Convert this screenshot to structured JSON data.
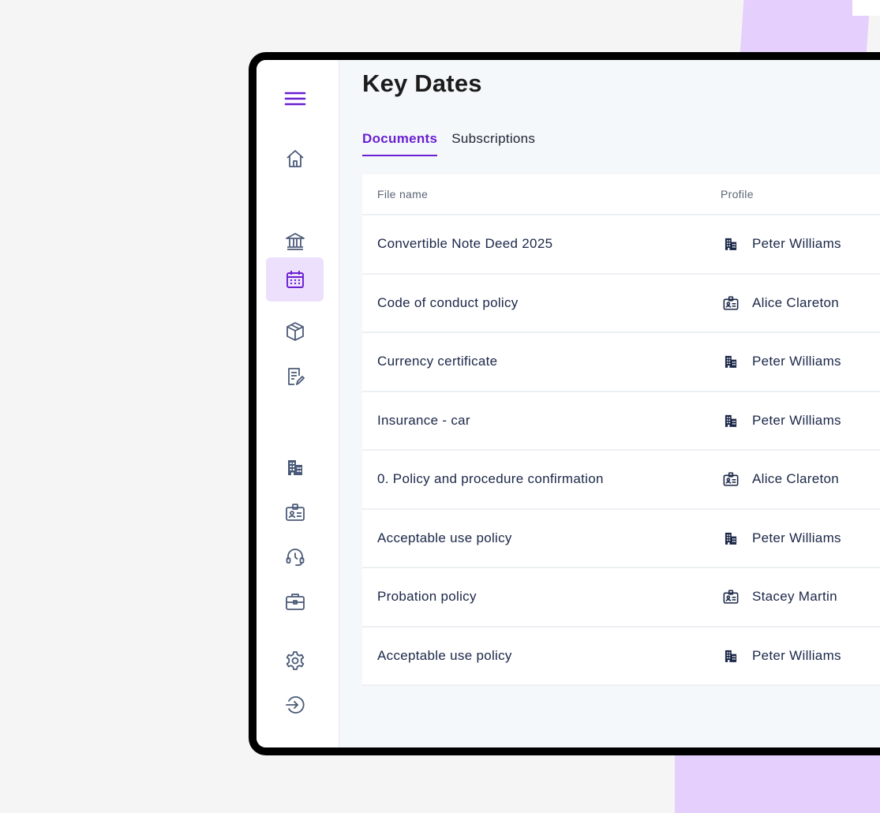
{
  "page": {
    "title": "Key Dates"
  },
  "tabs": [
    {
      "label": "Documents",
      "active": true
    },
    {
      "label": "Subscriptions",
      "active": false
    }
  ],
  "table": {
    "headers": {
      "file_name": "File name",
      "profile": "Profile"
    },
    "rows": [
      {
        "file_name": "Convertible Note Deed 2025",
        "profile": "Peter Williams",
        "profile_icon": "building-icon"
      },
      {
        "file_name": "Code of conduct policy",
        "profile": "Alice Clareton",
        "profile_icon": "id-card-icon"
      },
      {
        "file_name": "Currency certificate",
        "profile": "Peter Williams",
        "profile_icon": "building-icon"
      },
      {
        "file_name": "Insurance - car",
        "profile": "Peter Williams",
        "profile_icon": "building-icon"
      },
      {
        "file_name": "0. Policy and procedure confirmation",
        "profile": "Alice Clareton",
        "profile_icon": "id-card-icon"
      },
      {
        "file_name": "Acceptable use policy",
        "profile": "Peter Williams",
        "profile_icon": "building-icon"
      },
      {
        "file_name": "Probation policy",
        "profile": "Stacey Martin",
        "profile_icon": "id-card-icon"
      },
      {
        "file_name": "Acceptable use policy",
        "profile": "Peter Williams",
        "profile_icon": "building-icon"
      }
    ]
  },
  "sidebar": {
    "items": [
      {
        "icon": "menu-icon"
      },
      {
        "icon": "home-icon"
      },
      {
        "icon": "bank-icon"
      },
      {
        "icon": "calendar-icon",
        "active": true
      },
      {
        "icon": "package-icon"
      },
      {
        "icon": "document-edit-icon"
      },
      {
        "icon": "building-icon"
      },
      {
        "icon": "id-card-icon"
      },
      {
        "icon": "support-headset-icon"
      },
      {
        "icon": "briefcase-icon"
      },
      {
        "icon": "gear-icon"
      },
      {
        "icon": "logout-icon"
      }
    ]
  },
  "colors": {
    "accent": "#6a1fd1",
    "active_bg": "#ede0fd",
    "icon": "#4b5a78",
    "text": "#1b2748"
  }
}
